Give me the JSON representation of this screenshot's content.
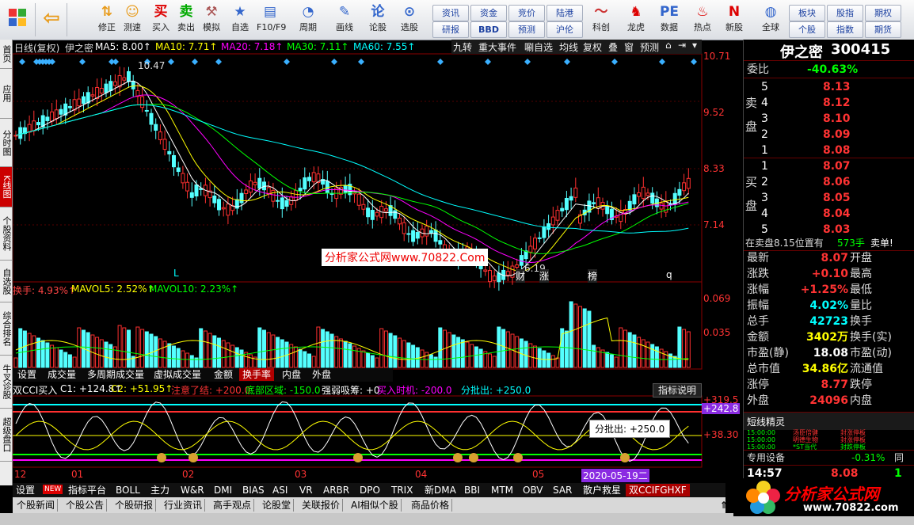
{
  "toolbar": {
    "items": [
      {
        "label": "",
        "icon": "back-arrow-icon"
      },
      {
        "label": "修正",
        "icon": "up-down-arrow-icon"
      },
      {
        "label": "测速",
        "icon": "smile-icon"
      },
      {
        "label": "买入",
        "icon": "buy-icon",
        "glyph": "买"
      },
      {
        "label": "卖出",
        "icon": "sell-icon",
        "glyph": "卖"
      },
      {
        "label": "模拟",
        "icon": "hammer-icon"
      },
      {
        "label": "自选",
        "icon": "star-folder-icon"
      },
      {
        "label": "F10/F9",
        "icon": "f10-icon"
      },
      {
        "label": "周期",
        "icon": "chart-period-icon"
      },
      {
        "label": "画线",
        "icon": "pen-icon"
      },
      {
        "label": "论股",
        "icon": "discuss-icon"
      },
      {
        "label": "选股",
        "icon": "filter-icon"
      },
      {
        "label": "科创",
        "icon": "line-chart-icon"
      },
      {
        "label": "龙虎",
        "icon": "dragon-icon"
      },
      {
        "label": "数据",
        "icon": "pe-icon",
        "glyph": "PE"
      },
      {
        "label": "热点",
        "icon": "flame-icon"
      },
      {
        "label": "新股",
        "icon": "new-stock-icon"
      },
      {
        "label": "全球",
        "icon": "globe-icon"
      }
    ],
    "minis": [
      "资讯",
      "资金",
      "竞价",
      "陆港",
      "研报",
      "BBD",
      "预测",
      "沪伦",
      "板块",
      "股指",
      "期权",
      "个股",
      "指数",
      "期货"
    ]
  },
  "left_tabs": [
    "首页",
    "应用",
    "分时图",
    "K线图",
    "个股资料",
    "自选股",
    "综合排名",
    "牛叉诊股",
    "超级盘口"
  ],
  "kline": {
    "title": "日线(复权)",
    "stock": "伊之密",
    "ma_labels": [
      {
        "text": "MA5: 8.00↑",
        "color": "#ffffff"
      },
      {
        "text": "MA10: 7.71↑",
        "color": "#ffff00"
      },
      {
        "text": "MA20: 7.18↑",
        "color": "#ff00ff"
      },
      {
        "text": "MA30: 7.11↑",
        "color": "#00ff00"
      },
      {
        "text": "MA60: 7.55↑",
        "color": "#00ffff"
      }
    ],
    "tools": [
      "九转",
      "重大事件",
      "唰自选",
      "均线",
      "复权",
      "叠",
      "窗",
      "预测"
    ],
    "axis": [
      "10.71",
      "9.52",
      "8.33",
      "7.14"
    ],
    "high_marker": "10.47",
    "low_marker": "6.19",
    "watermark": "分析家公式网www.70822.Com",
    "event_labels": [
      "L",
      "财",
      "涨",
      "榜",
      "q"
    ]
  },
  "volume": {
    "labels": [
      {
        "text": "换手: 4.93%↑",
        "color": "#ff4040"
      },
      {
        "text": "MAVOL5: 2.52%↑",
        "color": "#ffff00"
      },
      {
        "text": "MAVOL10: 2.23%↑",
        "color": "#00ff00"
      }
    ],
    "axis": [
      "0.069",
      "0.035"
    ],
    "tabs": [
      "设置",
      "成交量",
      "多周期成交量",
      "虚拟成交量",
      "金额",
      "换手率",
      "内盘",
      "外盘"
    ]
  },
  "indicator": {
    "labels": [
      {
        "text": "双CCI买入",
        "color": "#ffffff"
      },
      {
        "text": "C1: +124.8↑",
        "color": "#ffffff"
      },
      {
        "text": "C2: +51.95↑",
        "color": "#ffff00"
      },
      {
        "text": "注意了结: +200.0",
        "color": "#ff3030"
      },
      {
        "text": "底部区域: -150.0",
        "color": "#00ff00"
      },
      {
        "text": "强弱吸筹: +0",
        "color": "#ffffff"
      },
      {
        "text": "买入时机: -200.0",
        "color": "#ff00ff"
      },
      {
        "text": "分批出: +250.0",
        "color": "#00ffff"
      }
    ],
    "help_button": "指标说明",
    "axis": [
      "+319.5",
      "+242.8",
      "+38.30"
    ],
    "tooltip": "分批出: +250.0"
  },
  "date_axis": {
    "labels": [
      "12",
      "01",
      "02",
      "03",
      "04",
      "05"
    ],
    "highlight": "2020-05-19二"
  },
  "bottom_tabs": [
    "设置",
    "NEW",
    "指标平台",
    "BOLL",
    "主力",
    "W&R",
    "DMI",
    "BIAS",
    "ASI",
    "VR",
    "ARBR",
    "DPO",
    "TRIX",
    "新DMA",
    "BBI",
    "MTM",
    "OBV",
    "SAR",
    "散户救星",
    "双CCIFGHXF"
  ],
  "news_tabs": [
    "个股新闻",
    "个股公告",
    "个股研报",
    "行业资讯",
    "高手观点",
    "论股堂",
    "关联报价",
    "AI相似个股",
    "商品价格"
  ],
  "quote": {
    "name": "伊之密",
    "code": "300415",
    "weibi_label": "委比",
    "weibi": "-40.63%",
    "sell_label": "卖盘",
    "buy_label": "买盘",
    "sell": [
      {
        "lvl": "5",
        "price": "8.13"
      },
      {
        "lvl": "4",
        "price": "8.12"
      },
      {
        "lvl": "3",
        "price": "8.10"
      },
      {
        "lvl": "2",
        "price": "8.09"
      },
      {
        "lvl": "1",
        "price": "8.08"
      }
    ],
    "buy": [
      {
        "lvl": "1",
        "price": "8.07"
      },
      {
        "lvl": "2",
        "price": "8.06"
      },
      {
        "lvl": "3",
        "price": "8.05"
      },
      {
        "lvl": "4",
        "price": "8.04"
      },
      {
        "lvl": "5",
        "price": "8.03"
      }
    ],
    "sell_info": {
      "text": "在卖盘8.15位置有",
      "qty": "573手",
      "tail": "卖单!"
    },
    "stats": [
      {
        "k": "最新",
        "v": "8.07",
        "k2": "开盘",
        "v2": ""
      },
      {
        "k": "涨跌",
        "v": "+0.10",
        "k2": "最高",
        "v2": ""
      },
      {
        "k": "涨幅",
        "v": "+1.25%",
        "k2": "最低",
        "v2": ""
      },
      {
        "k": "振幅",
        "v": "4.02%",
        "k2": "量比",
        "v2": ""
      },
      {
        "k": "总手",
        "v": "42723",
        "k2": "换手",
        "v2": ""
      },
      {
        "k": "金额",
        "v": "3402万",
        "k2": "换手(实)",
        "v2": ""
      },
      {
        "k": "市盈(静)",
        "v": "18.08",
        "k2": "市盈(动)",
        "v2": ""
      },
      {
        "k": "总市值",
        "v": "34.86亿",
        "k2": "流通值",
        "v2": ""
      },
      {
        "k": "涨停",
        "v": "8.77",
        "k2": "跌停",
        "v2": ""
      },
      {
        "k": "外盘",
        "v": "24096",
        "k2": "内盘",
        "v2": ""
      }
    ],
    "short_title": "短线精灵",
    "short_lines": [
      {
        "time": "15:00:00",
        "name": "汤臣倍健",
        "event": "封涨停板"
      },
      {
        "time": "15:00:00",
        "name": "明德生物",
        "event": "封涨停板"
      },
      {
        "time": "15:00:00",
        "name": "*ST当代",
        "event": "封跌停板"
      }
    ],
    "sector": {
      "name": "专用设备",
      "pct": "-0.31%",
      "tail": "同"
    },
    "tick": {
      "time": "14:57",
      "price": "8.08",
      "qty": "1"
    }
  },
  "logo": {
    "text": "分析家公式网",
    "url": "www.70822.com"
  }
}
